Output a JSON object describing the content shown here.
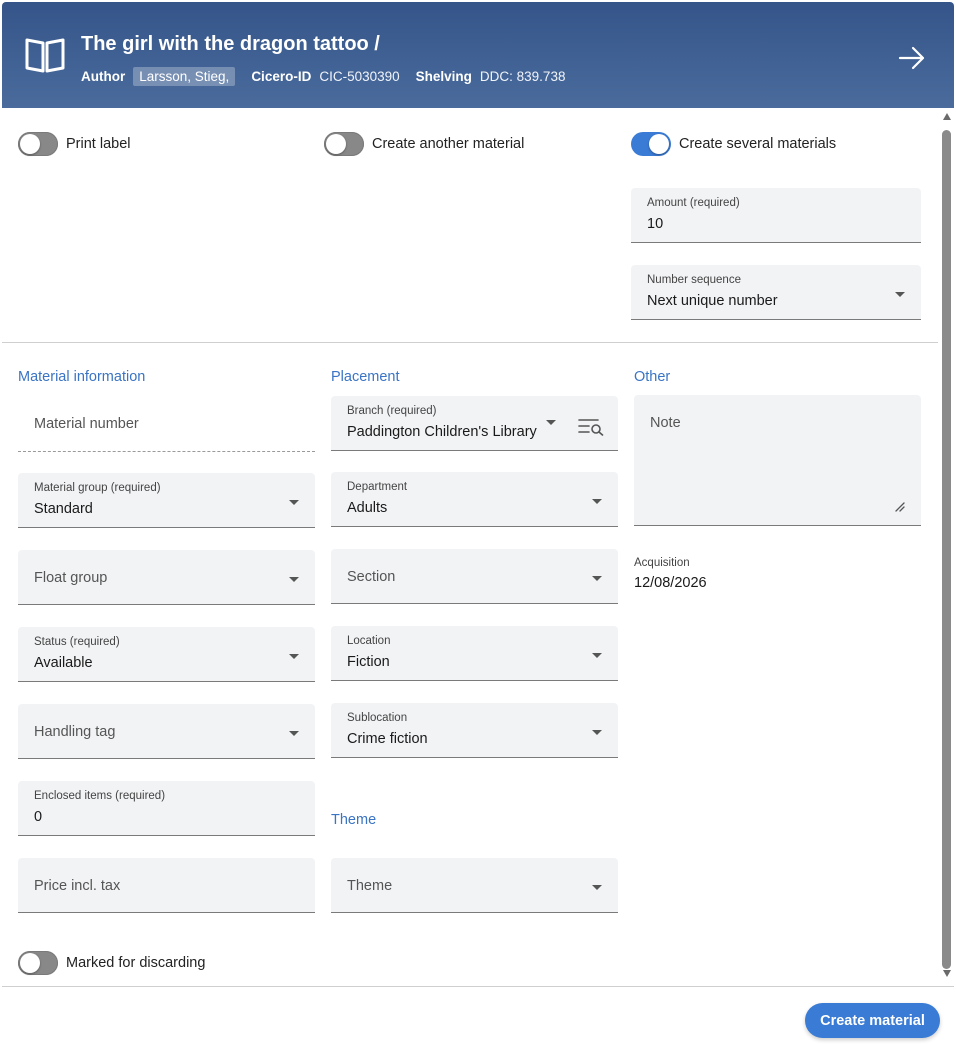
{
  "header": {
    "title": "The girl with the dragon tattoo /",
    "author_label": "Author",
    "author_value": "Larsson, Stieg,",
    "cicero_label": "Cicero-ID",
    "cicero_value": "CIC-5030390",
    "shelving_label": "Shelving",
    "shelving_value": "DDC: 839.738",
    "icon": "book-open-icon",
    "arrow_icon": "arrow-right-icon"
  },
  "toggles": {
    "print_label": {
      "label": "Print label",
      "on": false
    },
    "create_another": {
      "label": "Create another material",
      "on": false
    },
    "create_several": {
      "label": "Create several materials",
      "on": true
    },
    "marked_discarding": {
      "label": "Marked for discarding",
      "on": false
    }
  },
  "several": {
    "amount": {
      "label": "Amount (required)",
      "value": "10"
    },
    "number_sequence": {
      "label": "Number sequence",
      "value": "Next unique number"
    }
  },
  "sections": {
    "material_information": "Material information",
    "placement": "Placement",
    "other": "Other",
    "theme": "Theme"
  },
  "material": {
    "material_number": {
      "placeholder": "Material number"
    },
    "material_group": {
      "label": "Material group (required)",
      "value": "Standard"
    },
    "float_group": {
      "placeholder": "Float group"
    },
    "status": {
      "label": "Status (required)",
      "value": "Available"
    },
    "handling_tag": {
      "placeholder": "Handling tag"
    },
    "enclosed_items": {
      "label": "Enclosed items (required)",
      "value": "0"
    },
    "price": {
      "placeholder": "Price incl. tax"
    }
  },
  "placement": {
    "branch": {
      "label": "Branch (required)",
      "value": "Paddington Children's Library"
    },
    "department": {
      "label": "Department",
      "value": "Adults"
    },
    "section": {
      "placeholder": "Section"
    },
    "location": {
      "label": "Location",
      "value": "Fiction"
    },
    "sublocation": {
      "label": "Sublocation",
      "value": "Crime fiction"
    },
    "theme": {
      "placeholder": "Theme"
    }
  },
  "other": {
    "note": {
      "placeholder": "Note"
    },
    "acquisition": {
      "label": "Acquisition",
      "value": "12/08/2026"
    }
  },
  "footer": {
    "create_button": "Create material"
  },
  "colors": {
    "header_bg": "#4a6b9c",
    "accent": "#3a7bd5",
    "section_title": "#3a74c4"
  }
}
